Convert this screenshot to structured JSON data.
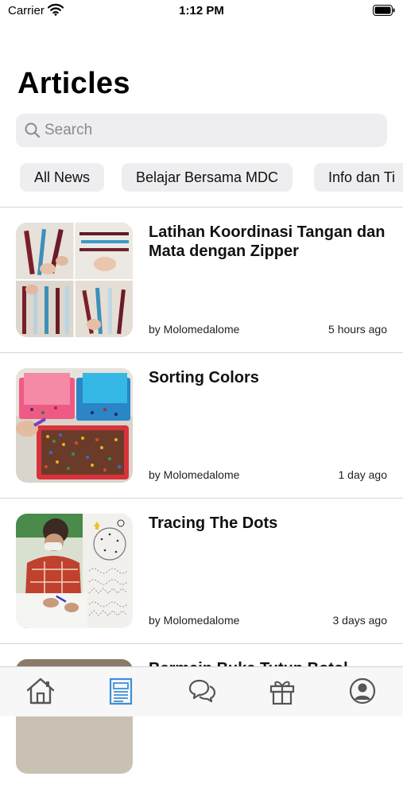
{
  "status_bar": {
    "carrier": "Carrier",
    "time": "1:12 PM"
  },
  "header": {
    "title": "Articles"
  },
  "search": {
    "placeholder": "Search"
  },
  "categories": [
    "All News",
    "Belajar Bersama MDC",
    "Info dan Ti"
  ],
  "articles": [
    {
      "title": "Latihan Koordinasi Tangan dan Mata dengan Zipper",
      "author": "by Molomedalome",
      "time": "5 hours ago",
      "thumbnail": "zipper-activity-photo"
    },
    {
      "title": "Sorting Colors",
      "author": "by Molomedalome",
      "time": "1 day ago",
      "thumbnail": "sorting-colors-photo"
    },
    {
      "title": "Tracing The Dots",
      "author": "by Molomedalome",
      "time": "3 days ago",
      "thumbnail": "tracing-dots-photo"
    },
    {
      "title": "Bermain Buka Tutup Botol",
      "thumbnail": "bottle-activity-photo"
    }
  ],
  "tab_bar": {
    "items": [
      "home-icon",
      "articles-icon",
      "chat-icon",
      "gift-icon",
      "profile-icon"
    ],
    "active": "articles-icon",
    "active_color": "#3d8fd6",
    "inactive_color": "#555555"
  }
}
